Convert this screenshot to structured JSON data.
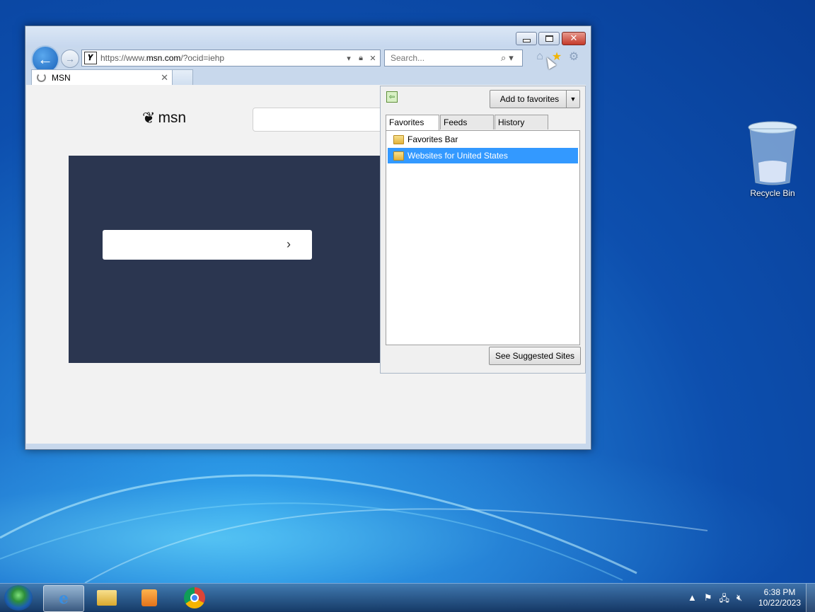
{
  "desktop": {
    "recycle_bin_label": "Recycle Bin"
  },
  "browser": {
    "address": {
      "url_prefix": "https://www.",
      "url_domain": "msn.com",
      "url_suffix": "/?ocid=iehp"
    },
    "search": {
      "placeholder": "Search..."
    },
    "tab": {
      "title": "MSN"
    },
    "page": {
      "logo_text": "msn"
    }
  },
  "favorites_pane": {
    "add_button": "Add to favorites",
    "tabs": [
      "Favorites",
      "Feeds",
      "History"
    ],
    "items": [
      {
        "label": "Favorites Bar",
        "selected": false
      },
      {
        "label": "Websites for United States",
        "selected": true
      }
    ],
    "suggested_button": "See Suggested Sites"
  },
  "taskbar": {
    "time": "6:38 PM",
    "date": "10/22/2023"
  },
  "colors": {
    "accent": "#3399ff",
    "hero_bg": "#2b3650"
  }
}
